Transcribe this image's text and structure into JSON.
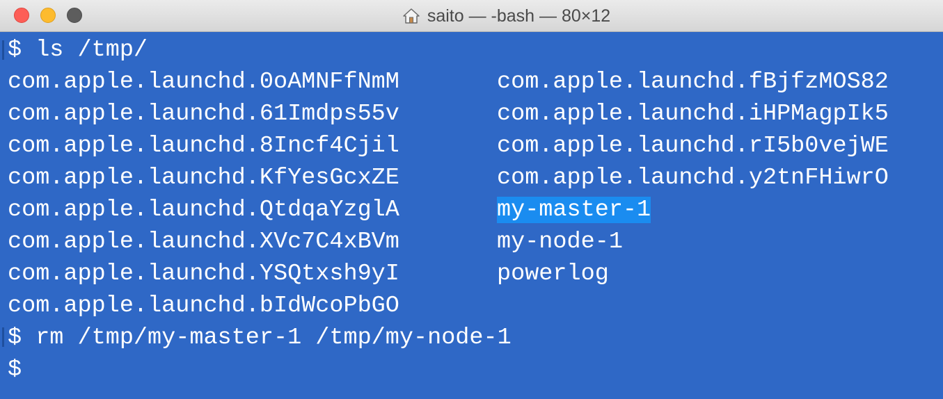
{
  "window": {
    "title": "saito — -bash — 80×12",
    "title_icon": "home-icon",
    "colors": {
      "background": "#2f68c6",
      "foreground": "#ffffff",
      "selection": "#1a8cf0",
      "close": "#fd5e57",
      "minimize": "#fdbb2e",
      "zoom": "#5d5d5d"
    }
  },
  "terminal": {
    "commands": {
      "ls": "$ ls /tmp/",
      "rm": "$ rm /tmp/my-master-1 /tmp/my-node-1",
      "prompt": "$"
    },
    "listing_col1": [
      "com.apple.launchd.0oAMNFfNmM",
      "com.apple.launchd.61Imdps55v",
      "com.apple.launchd.8Incf4Cjil",
      "com.apple.launchd.KfYesGcxZE",
      "com.apple.launchd.QtdqaYzglA",
      "com.apple.launchd.XVc7C4xBVm",
      "com.apple.launchd.YSQtxsh9yI",
      "com.apple.launchd.bIdWcoPbGO"
    ],
    "listing_col2": [
      "com.apple.launchd.fBjfzMOS82",
      "com.apple.launchd.iHPMagpIk5",
      "com.apple.launchd.rI5b0vejWE",
      "com.apple.launchd.y2tnFHiwrO",
      "my-master-1",
      "my-node-1",
      "powerlog"
    ],
    "selected_text": "my-master-1"
  }
}
